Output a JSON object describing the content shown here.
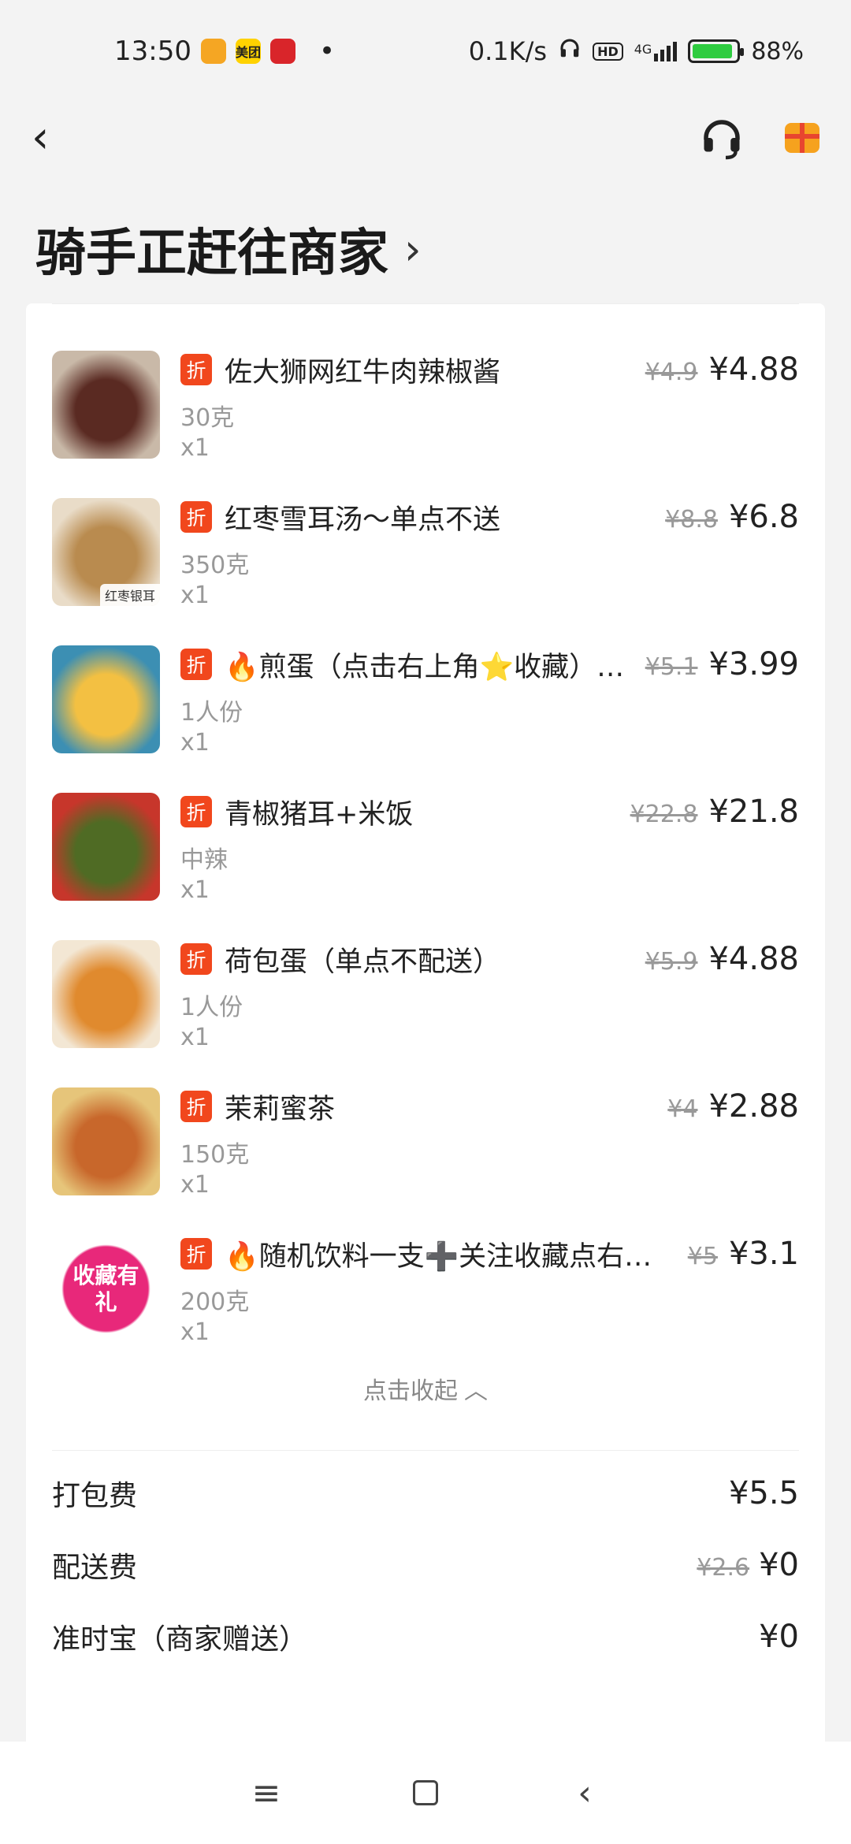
{
  "status_bar": {
    "time": "13:50",
    "app_icons": [
      {
        "name": "message-app-icon",
        "label": "",
        "color": "#f5a623"
      },
      {
        "name": "meituan-app-icon",
        "label": "美团",
        "color": "#ffd200"
      },
      {
        "name": "metro-app-icon",
        "label": "",
        "color": "#d9252a"
      }
    ],
    "dot": "•",
    "net_speed": "0.1K/s",
    "hd_label": "HD",
    "network": "4G",
    "battery": "88%"
  },
  "header": {
    "title": "骑手正赶往商家",
    "title_chevron": "›"
  },
  "items": [
    {
      "name": "佐大狮网红牛肉辣椒酱",
      "spec": "30克",
      "qty": "x1",
      "original_price": "¥4.9",
      "price": "¥4.88",
      "badge": "折",
      "thumb_colors": [
        "#5a2a22",
        "#c9b9a8"
      ],
      "thumb_caption": ""
    },
    {
      "name": "红枣雪耳汤～单点不送",
      "spec": "350克",
      "qty": "x1",
      "original_price": "¥8.8",
      "price": "¥6.8",
      "badge": "折",
      "thumb_colors": [
        "#b98b4f",
        "#e9dcc8"
      ],
      "thumb_caption": "红枣银耳"
    },
    {
      "name": "🔥煎蛋（点击右上角⭐收藏）（…",
      "spec": "1人份",
      "qty": "x1",
      "original_price": "¥5.1",
      "price": "¥3.99",
      "badge": "折",
      "thumb_colors": [
        "#f3c042",
        "#3c8fb3"
      ],
      "thumb_caption": ""
    },
    {
      "name": "青椒猪耳+米饭",
      "spec": "中辣",
      "qty": "x1",
      "original_price": "¥22.8",
      "price": "¥21.8",
      "badge": "折",
      "thumb_colors": [
        "#4f6b24",
        "#c7362b"
      ],
      "thumb_caption": ""
    },
    {
      "name": "荷包蛋（单点不配送）",
      "spec": "1人份",
      "qty": "x1",
      "original_price": "¥5.9",
      "price": "¥4.88",
      "badge": "折",
      "thumb_colors": [
        "#e08a2e",
        "#f3e7d4"
      ],
      "thumb_caption": ""
    },
    {
      "name": "茉莉蜜茶",
      "spec": "150克",
      "qty": "x1",
      "original_price": "¥4",
      "price": "¥2.88",
      "badge": "折",
      "thumb_colors": [
        "#c8672b",
        "#e6c57a"
      ],
      "thumb_caption": ""
    },
    {
      "name": "🔥随机饮料一支➕关注收藏点右…",
      "spec": "200克",
      "qty": "x1",
      "original_price": "¥5",
      "price": "¥3.1",
      "badge": "折",
      "thumb_colors": [
        "#e8287a",
        "#ffffff"
      ],
      "thumb_caption": "收藏有礼"
    }
  ],
  "collapse": {
    "label": "点击收起",
    "chevron": "︿"
  },
  "fees": [
    {
      "label": "打包费",
      "original": "",
      "value": "¥5.5"
    },
    {
      "label": "配送费",
      "original": "¥2.6",
      "value": "¥0"
    },
    {
      "label": "准时宝（商家赠送）",
      "original": "",
      "value": "¥0"
    }
  ],
  "nav": {
    "back": "‹",
    "menu_glyph": "≡",
    "back_glyph": "‹"
  },
  "colors": {
    "badge": "#f1471d",
    "background": "#f3f3f3"
  }
}
